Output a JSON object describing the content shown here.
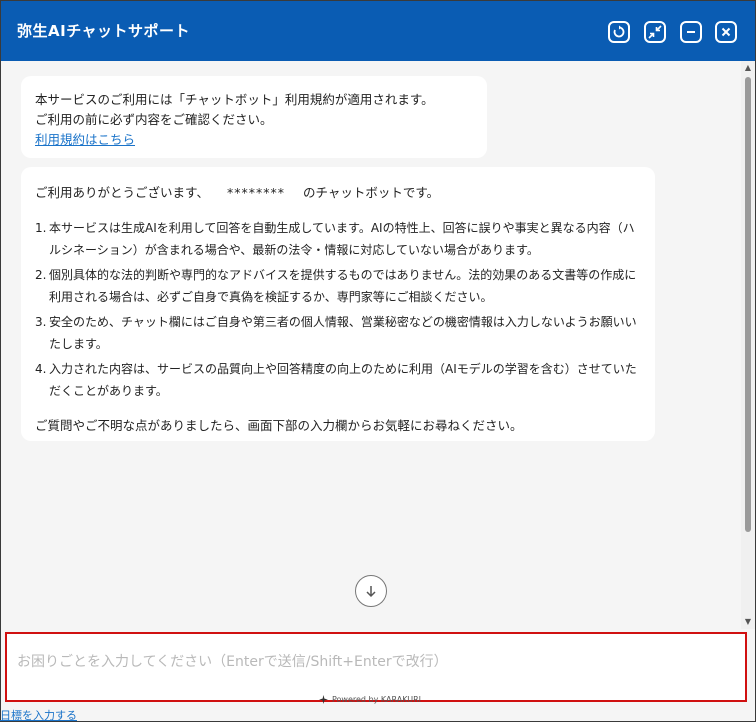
{
  "header": {
    "title": "弥生AIチャットサポート",
    "buttons": [
      "refresh-icon",
      "collapse-icon",
      "minimize-icon",
      "close-icon"
    ]
  },
  "messages": {
    "terms": {
      "line1": "本サービスのご利用には「チャットボット」利用規約が適用されます。",
      "line2": "ご利用の前に必ず内容をご確認ください。",
      "link": "利用規約はこちら"
    },
    "welcome": {
      "intro_prefix": "ご利用ありがとうございます、",
      "masked_name": "********",
      "intro_suffix": "のチャットボットです。",
      "items": [
        {
          "num": "1.",
          "text": "本サービスは生成AIを利用して回答を自動生成しています。AIの特性上、回答に誤りや事実と異なる内容（ハルシネーション）が含まれる場合や、最新の法令・情報に対応していない場合があります。"
        },
        {
          "num": "2.",
          "text": "個別具体的な法的判断や専門的なアドバイスを提供するものではありません。法的効果のある文書等の作成に利用される場合は、必ずご自身で真偽を検証するか、専門家等にご相談ください。"
        },
        {
          "num": "3.",
          "text": "安全のため、チャット欄にはご自身や第三者の個人情報、営業秘密などの機密情報は入力しないようお願いいたします。"
        },
        {
          "num": "4.",
          "text": "入力された内容は、サービスの品質向上や回答精度の向上のために利用（AIモデルの学習を含む）させていただくことがあります。"
        }
      ],
      "outro": "ご質問やご不明な点がありましたら、画面下部の入力欄からお気軽にお尋ねください。"
    }
  },
  "input": {
    "placeholder": "お困りごとを入力してください（Enterで送信/Shift+Enterで改行）"
  },
  "footer": {
    "powered_by": "Powered by KARAKURI",
    "behind_link": "日標を入力する"
  },
  "colors": {
    "header": "#0a5cb3",
    "highlight_border": "#d01010",
    "link": "#1a73c9"
  }
}
